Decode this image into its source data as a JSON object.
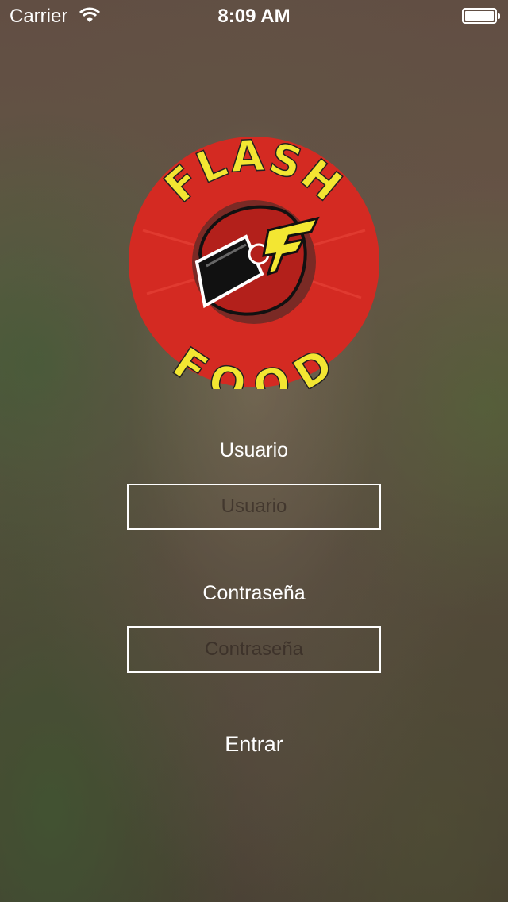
{
  "status_bar": {
    "carrier": "Carrier",
    "time": "8:09 AM"
  },
  "logo": {
    "top_word": "FLASH",
    "bottom_word": "FOOD",
    "emblem_letter": "F"
  },
  "login": {
    "username_label": "Usuario",
    "username_placeholder": "Usuario",
    "password_label": "Contraseña",
    "password_placeholder": "Contraseña",
    "submit_label": "Entrar"
  },
  "colors": {
    "logo_red": "#d42a22",
    "logo_yellow": "#f3e632"
  }
}
